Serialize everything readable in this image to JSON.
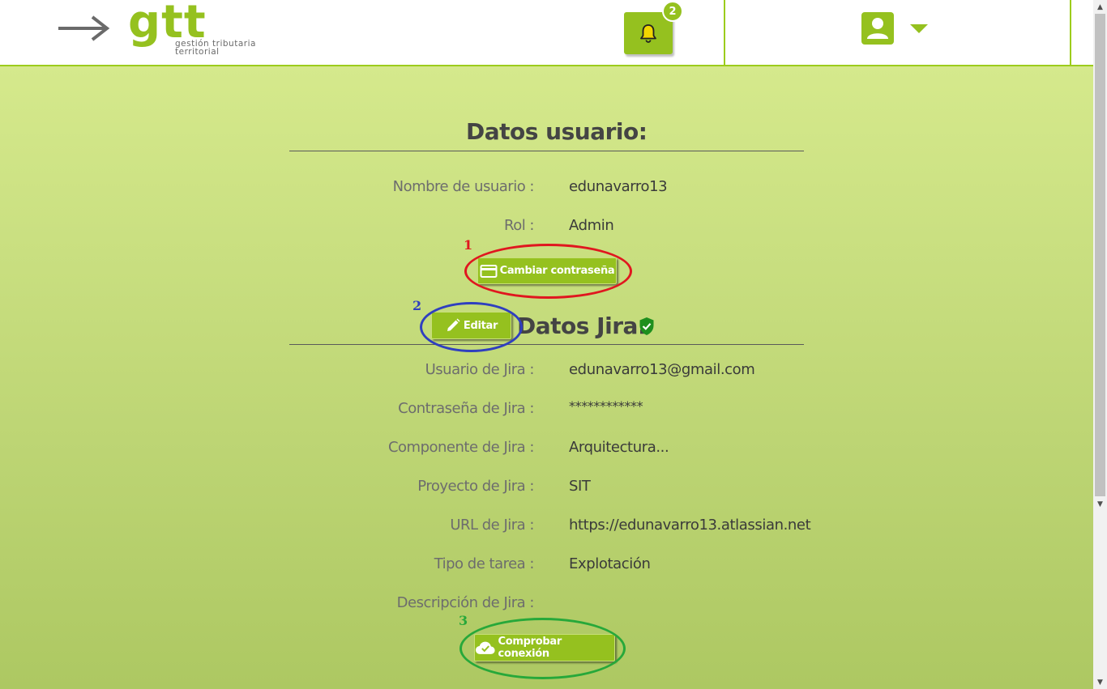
{
  "header": {
    "logo_word": "gtt",
    "logo_sub_line1": "gestión tributaria",
    "logo_sub_line2": "territorial",
    "notification_count": "2"
  },
  "user_section": {
    "title": "Datos usuario:",
    "fields": [
      {
        "label": "Nombre de usuario :",
        "value": "edunavarro13"
      },
      {
        "label": "Rol :",
        "value": "Admin"
      }
    ],
    "change_password_label": "Cambiar contraseña"
  },
  "jira_section": {
    "title": "Datos Jira:",
    "edit_label": "Editar",
    "fields": [
      {
        "label": "Usuario de Jira :",
        "value": "edunavarro13@gmail.com"
      },
      {
        "label": "Contraseña de Jira :",
        "value": "************"
      },
      {
        "label": "Componente de Jira :",
        "value": "Arquitectura..."
      },
      {
        "label": "Proyecto de Jira :",
        "value": "SIT"
      },
      {
        "label": "URL de Jira :",
        "value": "https://edunavarro13.atlassian.net"
      },
      {
        "label": "Tipo de tarea :",
        "value": "Explotación"
      },
      {
        "label": "Descripción de Jira :",
        "value": ""
      }
    ],
    "check_connection_label": "Comprobar conexión"
  },
  "annotations": [
    {
      "number": "1",
      "color": "#e0171f"
    },
    {
      "number": "2",
      "color": "#2f3fbf"
    },
    {
      "number": "3",
      "color": "#27a83a"
    }
  ],
  "colors": {
    "brand_green": "#95c11f",
    "verified_green": "#1e8f1e"
  }
}
